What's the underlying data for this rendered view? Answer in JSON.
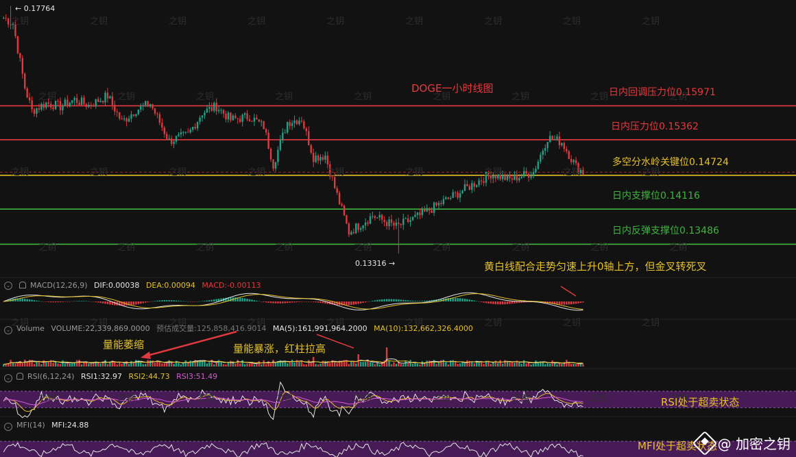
{
  "main": {
    "title": "DOGE一小时线图",
    "high_marker": "← 0.17764",
    "low_marker": "0.13316 →",
    "levels": [
      {
        "label": "日内回调压力位0.15971",
        "price": 0.15971,
        "color": "#e8393f",
        "text_color": "#e8393f"
      },
      {
        "label": "日内压力位0.15362",
        "price": 0.15362,
        "color": "#e8393f",
        "text_color": "#e8393f"
      },
      {
        "label": "多空分水岭关键位0.14724",
        "price": 0.14724,
        "color": "#e6c229",
        "text_color": "#e6c229"
      },
      {
        "label": "日内支撑位0.14116",
        "price": 0.14116,
        "color": "#3fb53f",
        "text_color": "#3fb53f"
      },
      {
        "label": "日内反弹支撑位0.13486",
        "price": 0.13486,
        "color": "#3fb53f",
        "text_color": "#3fb53f"
      }
    ],
    "annotation": "黄白线配合走势匀速上升0轴上方，但金叉转死叉"
  },
  "macd": {
    "label": "MACD(12,26,9)",
    "dif": "DIF:0.00038",
    "dea": "DEA:0.00094",
    "macd": "MACD:-0.00113"
  },
  "volume": {
    "label": "Volume",
    "volume": "VOLUME:22,339,869.0000",
    "forecast": "预估成交量:125,858,416.9014",
    "ma5": "MA(5):161,991,964.2000",
    "ma10": "MA(10):132,662,326.4000",
    "note_shrink": "量能萎缩",
    "note_surge": "量能暴涨，红柱拉高"
  },
  "rsi": {
    "label": "RSI(6,12,24)",
    "rsi1": "RSI1:32.97",
    "rsi2": "RSI2:44.73",
    "rsi3": "RSI3:51.49",
    "note": "RSI处于超卖状态"
  },
  "mfi": {
    "label": "MFI(14)",
    "value": "MFI:24.88",
    "note": "MFI处于超卖状态"
  },
  "watermark": "之钥",
  "logo": {
    "text": "@ 加密之钥"
  },
  "colors": {
    "up": "#1ea388",
    "down": "#e0393f",
    "yellow": "#e6c229",
    "white": "#e6e6e6",
    "purple": "#5a1f6e",
    "pink": "#d65ad6"
  },
  "chart_data": {
    "type": "candlestick",
    "title": "DOGE一小时线图",
    "high": 0.17764,
    "low": 0.13316,
    "ylim": [
      0.1295,
      0.1787
    ],
    "close_path_anchors": [
      [
        0,
        0.1755
      ],
      [
        4,
        0.1745
      ],
      [
        9,
        0.163
      ],
      [
        12,
        0.1588
      ],
      [
        18,
        0.1602
      ],
      [
        24,
        0.1596
      ],
      [
        30,
        0.1608
      ],
      [
        36,
        0.1598
      ],
      [
        44,
        0.1615
      ],
      [
        50,
        0.1568
      ],
      [
        56,
        0.159
      ],
      [
        62,
        0.1601
      ],
      [
        70,
        0.1534
      ],
      [
        78,
        0.1545
      ],
      [
        84,
        0.1585
      ],
      [
        90,
        0.1596
      ],
      [
        96,
        0.1572
      ],
      [
        104,
        0.1578
      ],
      [
        110,
        0.156
      ],
      [
        114,
        0.1492
      ],
      [
        120,
        0.1568
      ],
      [
        126,
        0.1574
      ],
      [
        131,
        0.1505
      ],
      [
        136,
        0.1508
      ],
      [
        140,
        0.145
      ],
      [
        146,
        0.137
      ],
      [
        156,
        0.14
      ],
      [
        166,
        0.138
      ],
      [
        176,
        0.14
      ],
      [
        186,
        0.1425
      ],
      [
        196,
        0.145
      ],
      [
        206,
        0.1475
      ],
      [
        214,
        0.1465
      ],
      [
        224,
        0.1478
      ],
      [
        230,
        0.154
      ],
      [
        236,
        0.1532
      ],
      [
        242,
        0.1488
      ],
      [
        245,
        0.1478
      ]
    ],
    "candle_count": 246,
    "levels": [
      0.15971,
      0.15362,
      0.14724,
      0.14116,
      0.13486
    ]
  }
}
